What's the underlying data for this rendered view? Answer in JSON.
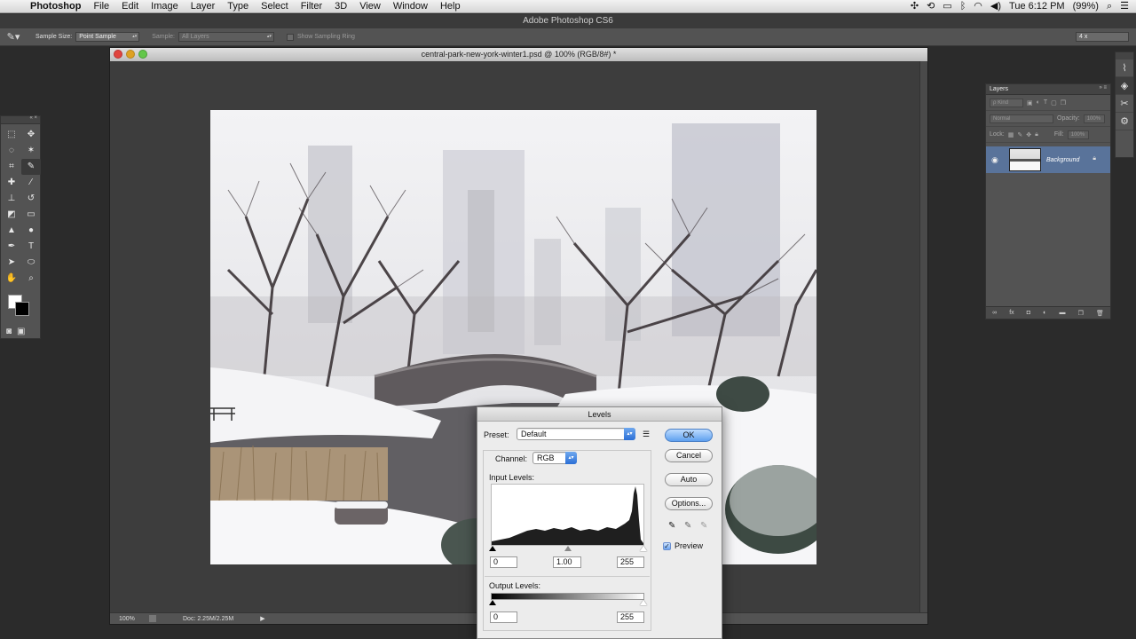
{
  "menubar": {
    "items": [
      "Photoshop",
      "File",
      "Edit",
      "Image",
      "Layer",
      "Type",
      "Select",
      "Filter",
      "3D",
      "View",
      "Window",
      "Help"
    ],
    "clock": "Tue 6:12 PM",
    "battery": "(99%)"
  },
  "app": {
    "title": "Adobe Photoshop CS6"
  },
  "options": {
    "sample_size_label": "Sample Size:",
    "sample_size_value": "Point Sample",
    "sample_label": "Sample:",
    "sample_value": "All Layers",
    "show_ring_label": "Show Sampling Ring",
    "zoom_value": "4 x"
  },
  "document": {
    "title": "central-park-new-york-winter1.psd @ 100% (RGB/8#) *",
    "zoom": "100%",
    "doc_size": "Doc: 2.25M/2.25M"
  },
  "layers_panel": {
    "tab": "Layers",
    "kind": "ρ Kind",
    "blend": "Normal",
    "opacity_label": "Opacity:",
    "opacity_value": "100%",
    "lock_label": "Lock:",
    "fill_label": "Fill:",
    "fill_value": "100%",
    "layer_name": "Background"
  },
  "levels": {
    "title": "Levels",
    "preset_label": "Preset:",
    "preset_value": "Default",
    "channel_label": "Channel:",
    "channel_value": "RGB",
    "input_label": "Input Levels:",
    "input_black": "0",
    "input_gamma": "1.00",
    "input_white": "255",
    "output_label": "Output Levels:",
    "output_black": "0",
    "output_white": "255",
    "ok": "OK",
    "cancel": "Cancel",
    "auto": "Auto",
    "options": "Options...",
    "preview": "Preview"
  },
  "colors": {
    "layer_selected": "#59739a",
    "default_button": "#5ea0ef"
  }
}
